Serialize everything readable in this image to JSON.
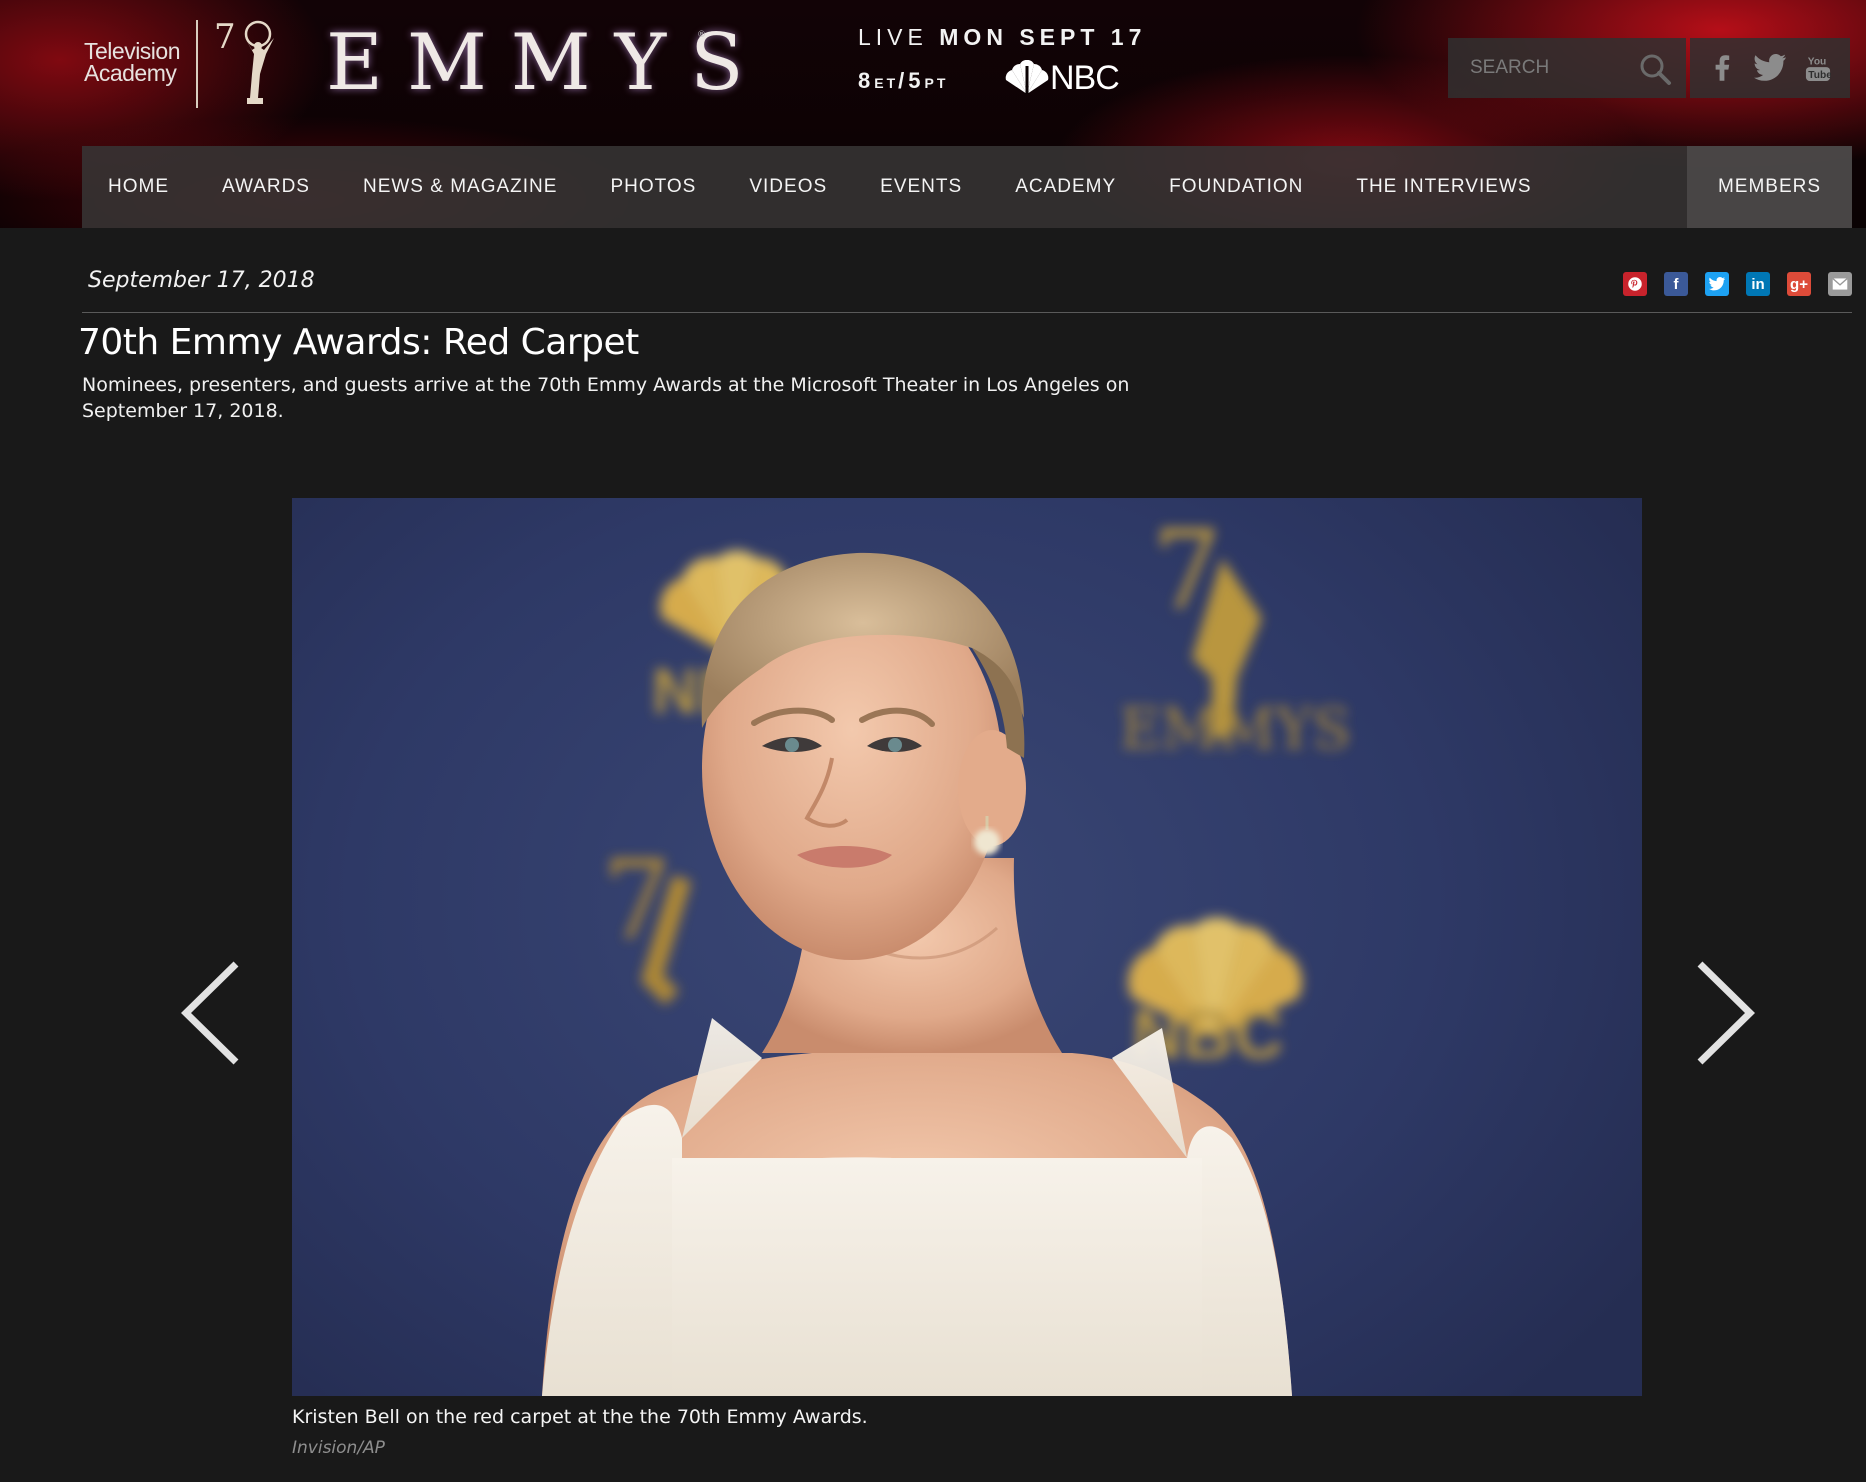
{
  "header": {
    "academy_line1": "Television",
    "academy_line2": "Academy",
    "brand": "EMMYS",
    "live_prefix": "LIVE",
    "live_day": "MON SEPT 17",
    "time_et": "8",
    "time_et_suffix": "ET",
    "time_pt": "5",
    "time_pt_suffix": "PT",
    "network": "NBC",
    "search_placeholder": "SEARCH"
  },
  "social_icons": [
    "facebook-icon",
    "twitter-icon",
    "youtube-icon"
  ],
  "nav": {
    "items": [
      "HOME",
      "AWARDS",
      "NEWS & MAGAZINE",
      "PHOTOS",
      "VIDEOS",
      "EVENTS",
      "ACADEMY",
      "FOUNDATION",
      "THE INTERVIEWS"
    ],
    "members": "MEMBERS"
  },
  "article": {
    "date": "September 17, 2018",
    "title": "70th Emmy Awards: Red Carpet",
    "subtitle": "Nominees, presenters, and guests arrive at the 70th Emmy Awards at the Microsoft Theater in Los Angeles on September 17, 2018."
  },
  "share_buttons": [
    {
      "icon": "pinterest-icon",
      "glyph": "P",
      "color": "#c8232c"
    },
    {
      "icon": "facebook-icon",
      "glyph": "f",
      "color": "#3b5998"
    },
    {
      "icon": "twitter-icon",
      "glyph": "t",
      "color": "#1da1f2"
    },
    {
      "icon": "linkedin-icon",
      "glyph": "in",
      "color": "#0077b5"
    },
    {
      "icon": "google-plus-icon",
      "glyph": "g+",
      "color": "#dd4b39"
    },
    {
      "icon": "email-icon",
      "glyph": "✉",
      "color": "#9a9a9a"
    }
  ],
  "gallery": {
    "backdrop_text_1": "NBC",
    "backdrop_text_2": "EMMYS",
    "backdrop_text_3": "NBC",
    "caption": "Kristen Bell on the red carpet at the the 70th Emmy Awards.",
    "credit": "Invision/AP"
  },
  "colors": {
    "page_bg": "#191919",
    "header_red": "#be0f19",
    "nav_bg": "#373434",
    "backdrop_blue": "#2e3966",
    "gold": "#d8a437"
  }
}
